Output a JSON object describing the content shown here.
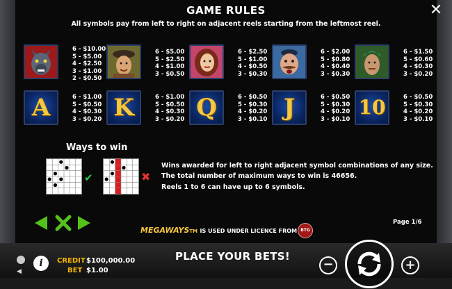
{
  "header": {
    "title": "GAME RULES",
    "subtitle": "All symbols pay from left to right on adjacent reels starting from the leftmost reel.",
    "close_icon": "close-icon"
  },
  "symbols_row1": [
    {
      "name": "werewolf",
      "pays": "6 - $10.00\n5 - $5.00\n4 - $2.50\n3 - $1.00\n2 - $0.50"
    },
    {
      "name": "hunter",
      "pays": "6 - $5.00\n5 - $2.50\n4 - $1.00\n3 - $0.50"
    },
    {
      "name": "red-haired-woman",
      "pays": "6 - $2.50\n5 - $1.00\n4 - $0.50\n3 - $0.30"
    },
    {
      "name": "mustached-man",
      "pays": "6 - $2.00\n5 - $0.80\n4 - $0.40\n3 - $0.30"
    },
    {
      "name": "green-haired-man",
      "pays": "6 - $1.50\n5 - $0.60\n4 - $0.30\n3 - $0.20"
    }
  ],
  "symbols_row2": [
    {
      "label": "A",
      "pays": "6 - $1.00\n5 - $0.50\n4 - $0.30\n3 - $0.20"
    },
    {
      "label": "K",
      "pays": "6 - $1.00\n5 - $0.50\n4 - $0.30\n3 - $0.20"
    },
    {
      "label": "Q",
      "pays": "6 - $0.50\n5 - $0.30\n4 - $0.20\n3 - $0.10"
    },
    {
      "label": "J",
      "pays": "6 - $0.50\n5 - $0.30\n4 - $0.20\n3 - $0.10"
    },
    {
      "label": "10",
      "pays": "6 - $0.50\n5 - $0.30\n4 - $0.20\n3 - $0.10"
    }
  ],
  "ways": {
    "title": "Ways to win",
    "line1": "Wins awarded for left to right adjacent symbol combinations of any size.",
    "line2": "The total number of maximum ways to win is 46656.",
    "line3": "Reels 1 to 6 can have up to 6 symbols.",
    "valid_icon": "check-icon",
    "invalid_icon": "cross-icon"
  },
  "nav": {
    "prev_icon": "arrow-left-icon",
    "close_icon": "x-icon",
    "next_icon": "arrow-right-icon",
    "page": "Page 1/6"
  },
  "license": {
    "brand": "MEGAWAYS",
    "tm": "TM",
    "text": "IS USED UNDER LICENCE FROM",
    "logo": "BTG"
  },
  "bottom": {
    "credit_label": "CREDIT",
    "credit_value": "$100,000.00",
    "bet_label": "BET",
    "bet_value": "$1.00",
    "center_text": "PLACE YOUR BETS!",
    "minus": "−",
    "plus": "+",
    "info": "i"
  },
  "colors": {
    "accent_gold": "#f5c842",
    "label_orange": "#f5b400",
    "nav_green": "#55c21b",
    "card_blue": "#0a2560"
  }
}
